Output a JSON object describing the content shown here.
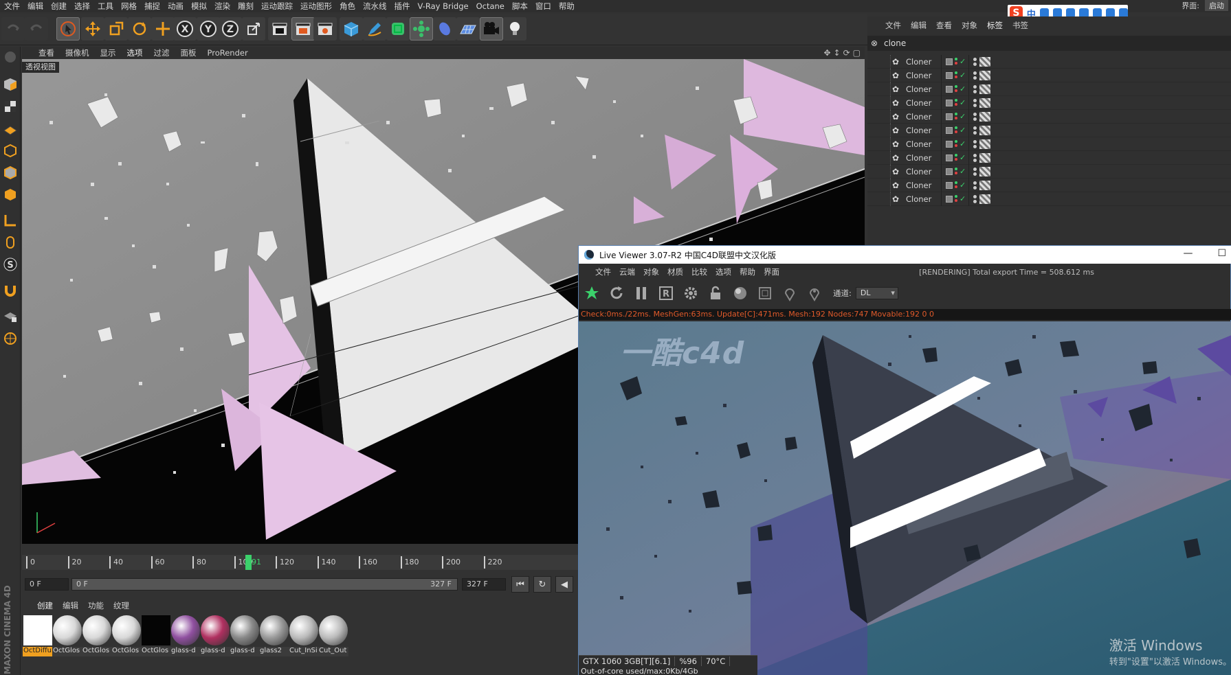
{
  "menubar": {
    "items": [
      "文件",
      "编辑",
      "创建",
      "选择",
      "工具",
      "网格",
      "捕捉",
      "动画",
      "模拟",
      "渲染",
      "雕刻",
      "运动跟踪",
      "运动图形",
      "角色",
      "流水线",
      "插件",
      "V-Ray Bridge",
      "Octane",
      "脚本",
      "窗口",
      "帮助"
    ],
    "layout_label": "界面:",
    "layout_value": "启动"
  },
  "ime": {
    "logo": "S",
    "lang": "中"
  },
  "toolbar": {
    "buttons": [
      "undo-icon",
      "redo-icon",
      "select-live-icon",
      "move-icon",
      "scale-icon",
      "rotate-icon",
      "create-axis-icon",
      "x-axis-icon",
      "y-axis-icon",
      "z-axis-icon",
      "coord-system-icon",
      "render-view-icon",
      "render-picture-viewer-icon",
      "render-settings-icon",
      "cube-icon",
      "pen-icon",
      "subdivision-icon",
      "cloner-icon",
      "deformer-icon",
      "floor-icon",
      "camera-icon",
      "light-icon"
    ],
    "axis": {
      "x": "X",
      "y": "Y",
      "z": "Z"
    }
  },
  "viewport": {
    "menu": [
      "查看",
      "摄像机",
      "显示",
      "选项",
      "过滤",
      "面板",
      "ProRender"
    ],
    "selected_menu": "选项",
    "label": "透视视图"
  },
  "timeline": {
    "ticks": [
      "0",
      "20",
      "40",
      "60",
      "80",
      "100",
      "120",
      "140",
      "160",
      "180",
      "200",
      "220"
    ],
    "current_frame": "91",
    "start_field": "0 F",
    "range_start": "0 F",
    "range_end": "327 F",
    "end_field": "327 F"
  },
  "material_manager": {
    "menu": [
      "创建",
      "编辑",
      "功能",
      "纹理"
    ],
    "materials": [
      {
        "name": "OctDiffu",
        "color": "#ffffff"
      },
      {
        "name": "OctGlos",
        "color": "#d8d8d8"
      },
      {
        "name": "OctGlos",
        "color": "#d8d8d8"
      },
      {
        "name": "OctGlos",
        "color": "#d8d8d8"
      },
      {
        "name": "OctGlos",
        "color": "#050505"
      },
      {
        "name": "glass-d",
        "color": "#9050a0"
      },
      {
        "name": "glass-d",
        "color": "#b03060"
      },
      {
        "name": "glass-d",
        "color": "#888888"
      },
      {
        "name": "glass2",
        "color": "#999999"
      },
      {
        "name": "Cut_InSi",
        "color": "#bbbbbb"
      },
      {
        "name": "Cut_Out",
        "color": "#bbbbbb"
      }
    ]
  },
  "brand": "MAXON CINEMA 4D",
  "object_manager": {
    "menu": [
      "文件",
      "编辑",
      "查看",
      "对象",
      "标签",
      "书签"
    ],
    "selected_menu": "标签",
    "search_value": "clone",
    "rows": [
      "Cloner",
      "Cloner",
      "Cloner",
      "Cloner",
      "Cloner",
      "Cloner",
      "Cloner",
      "Cloner",
      "Cloner",
      "Cloner",
      "Cloner"
    ]
  },
  "live_viewer": {
    "title": "Live Viewer 3.07-R2 中国C4D联盟中文汉化版",
    "menu": [
      "文件",
      "云端",
      "对象",
      "材质",
      "比较",
      "选项",
      "帮助",
      "界面"
    ],
    "status": "[RENDERING] Total export Time = 508.612 ms",
    "channel_label": "通道:",
    "channel_value": "DL",
    "stats": "Check:0ms./22ms. MeshGen:63ms. Update[C]:471ms. Mesh:192 Nodes:747 Movable:192  0 0",
    "watermark": "一酷c4d",
    "gpu": "GTX 1060 3GB[T][6.1]",
    "gpu_usage": "%96",
    "gpu_temp": "70°C",
    "out_of_core": "Out-of-core used/max:0Kb/4Gb",
    "windows_activate_title": "激活 Windows",
    "windows_activate_sub": "转到\"设置\"以激活 Windows。"
  }
}
